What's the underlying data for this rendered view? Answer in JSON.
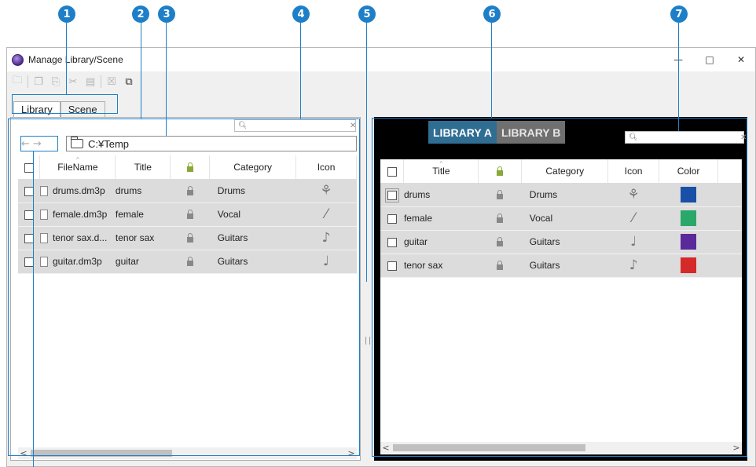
{
  "callouts": [
    "1",
    "2",
    "3",
    "4",
    "5",
    "6",
    "7"
  ],
  "window": {
    "title": "Manage Library/Scene",
    "minimize": "—",
    "maximize": "□",
    "close": "✕"
  },
  "toolbar": {
    "icons": [
      "new-folder-icon",
      "copy-icon",
      "paste-icon",
      "cut-icon",
      "clipboard-icon",
      "delete-icon",
      "duplicate-icon"
    ]
  },
  "tabs": [
    "Library",
    "Scene"
  ],
  "left": {
    "nav_back": "←",
    "nav_forward": "→",
    "path": "C:¥Temp",
    "columns": [
      "FileName",
      "Title",
      "Category",
      "Icon"
    ],
    "rows": [
      {
        "file": "drums.dm3p",
        "title": "drums",
        "category": "Drums",
        "icon": "drums-icon"
      },
      {
        "file": "female.dm3p",
        "title": "female",
        "category": "Vocal",
        "icon": "microphone-icon"
      },
      {
        "file": "tenor sax.d...",
        "title": "tenor sax",
        "category": "Guitars",
        "icon": "saxophone-icon"
      },
      {
        "file": "guitar.dm3p",
        "title": "guitar",
        "category": "Guitars",
        "icon": "guitar-icon"
      }
    ]
  },
  "right": {
    "library_tabs": [
      "LIBRARY A",
      "LIBRARY B"
    ],
    "columns": [
      "Title",
      "Category",
      "Icon",
      "Color"
    ],
    "rows": [
      {
        "title": "drums",
        "category": "Drums",
        "icon": "drums-icon",
        "color": "#1a4fa8"
      },
      {
        "title": "female",
        "category": "Vocal",
        "icon": "microphone-icon",
        "color": "#2aa86a"
      },
      {
        "title": "guitar",
        "category": "Guitars",
        "icon": "guitar-icon",
        "color": "#5a2a9a"
      },
      {
        "title": "tenor sax",
        "category": "Guitars",
        "icon": "saxophone-icon",
        "color": "#d42a2a"
      }
    ]
  },
  "scroll": {
    "left_arrow": "<",
    "right_arrow": ">"
  },
  "colors": {
    "accent": "#1e7fc8",
    "row_bg": "#dcdcdc"
  }
}
